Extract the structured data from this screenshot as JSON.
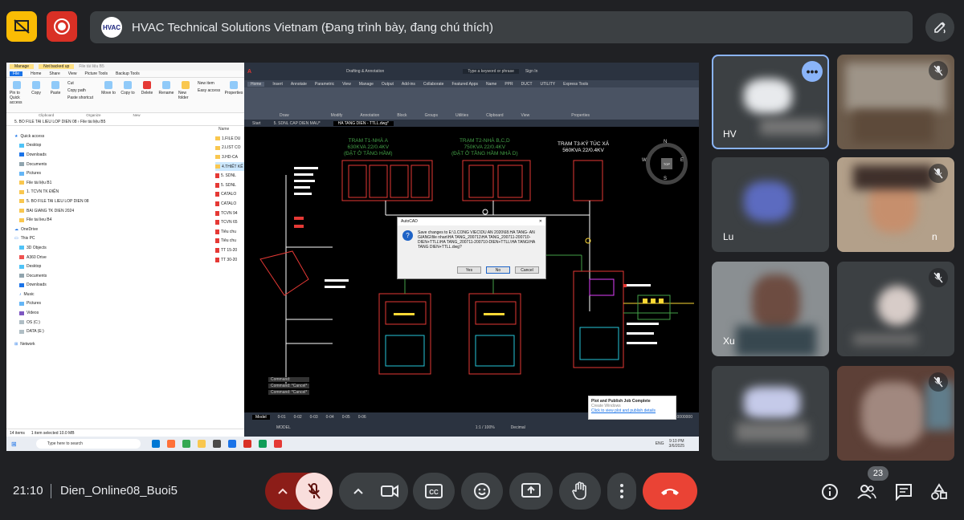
{
  "meet": {
    "presentation_title": "HVAC Technical Solutions Vietnam (Đang trình bày, đang chú thích)",
    "presenter_logo_text": "HVAC",
    "time": "21:10",
    "meeting_name": "Dien_Online08_Buoi5",
    "participant_count": "23",
    "colors": {
      "background": "#202124",
      "control": "#3c4043",
      "mic_muted": "#f9dedc",
      "end_call": "#ea4335",
      "highlight": "#8ab4f8"
    }
  },
  "participants": [
    {
      "name": "HV",
      "muted": false,
      "active_speaker": true
    },
    {
      "name": "",
      "muted": true
    },
    {
      "name": "Lu",
      "muted": false,
      "name_suffix": "n"
    },
    {
      "name": "",
      "muted": true
    },
    {
      "name": "Xu",
      "muted": false
    },
    {
      "name": "",
      "muted": true
    },
    {
      "name": "",
      "muted": false
    },
    {
      "name": "",
      "muted": true
    }
  ],
  "explorer": {
    "title_tabs": [
      "Manage",
      "Not backed up",
      "File tài liệu B5"
    ],
    "ribbon_tabs": [
      "File",
      "Home",
      "Share",
      "View",
      "Picture Tools",
      "Backup Tools"
    ],
    "ribbon_items": [
      "Pin to Quick access",
      "Copy",
      "Paste",
      "Cut",
      "Copy path",
      "Paste shortcut",
      "Move to",
      "Copy to",
      "Delete",
      "Rename",
      "New folder",
      "New item",
      "Easy access",
      "Properties"
    ],
    "ribbon_groups": [
      "Clipboard",
      "Organize",
      "New"
    ],
    "address": "5. BO FILE TAI LIEU LOP DIEN 08 › File tài liệu B5",
    "nav": [
      "Quick access",
      "Desktop",
      "Downloads",
      "Documents",
      "Pictures",
      "File tài liệu B1",
      "1. TCVN TK ĐIỆN",
      "5. BO FILE TAI LIEU LOP DIEN 08",
      "BAI GIANG TK DIEN 2024",
      "File tai lieu B4",
      "OneDrive",
      "This PC",
      "3D Objects",
      "A360 Drive",
      "Desktop",
      "Documents",
      "Downloads",
      "Music",
      "Pictures",
      "Videos",
      "OS (C:)",
      "DATA (E:)",
      "Network"
    ],
    "list_header": "Name",
    "list": [
      "1.FILE DU",
      "2.LIST CO",
      "3.HD-CA",
      "4.THIẾT KẾ",
      "5. SDNL",
      "5. SDNL",
      "CATALO",
      "CATALO",
      "TCVN 94",
      "TCVN 65",
      "Tiêu chu",
      "Tiêu chu",
      "TT 15-20",
      "TT 30-20"
    ],
    "status_count": "14 items",
    "status_selected": "1 item selected 10.0 MB"
  },
  "autocad": {
    "workspace": "Drafting & Annotation",
    "search_placeholder": "Type a keyword or phrase",
    "signin": "Sign In",
    "ribbon_tabs": [
      "Home",
      "Insert",
      "Annotate",
      "Parametric",
      "View",
      "Manage",
      "Output",
      "Add-ins",
      "Collaborate",
      "Featured Apps",
      "Name",
      "PPR",
      "DUCT",
      "UTILITY",
      "Express Tools"
    ],
    "panels": [
      "Draw",
      "Modify",
      "Annotation",
      "Block",
      "Groups",
      "Utilities",
      "Clipboard",
      "View",
      "Properties"
    ],
    "doc_tabs": [
      "Start",
      "5. SDNL CAP DIEN MAU*",
      "HA TANG DIEN - TTLL.dwg*"
    ],
    "stations": [
      {
        "name": "TRAM T1-NHÀ A",
        "rating": "630KVA 22/0.4KV",
        "note": "(ĐẶT Ở TẦNG HẦM)"
      },
      {
        "name": "TRẠM T2-NHÀ B,C,D",
        "rating": "750KVA 22/0.4KV",
        "note": "(ĐẶT Ở TẦNG HẦM NHÀ D)"
      },
      {
        "name": "TRẠM T3-KÝ TÚC XÁ",
        "rating": "560KVA 22/0.4KV",
        "note": ""
      }
    ],
    "viewcube": {
      "top": "TOP",
      "n": "N",
      "s": "S",
      "e": "E",
      "w": "W"
    },
    "dialog": {
      "title": "AutoCAD",
      "message": "Save changes to E:\\1.CONG VIEC\\DU AN 2020\\68.HA TANG- AN GIANG\\file nhan\\HA TANG_200711\\HA TANG_200711-200710-DIEN+TTLL\\HA TANG_200711-200710-DIEN+TTLL\\HA TANG\\HA TANG DIEN+TTLL.dwg?",
      "yes": "Yes",
      "no": "No",
      "cancel": "Cancel"
    },
    "commands": [
      "Command:",
      "Command: *Cancel*",
      "Command: *Cancel*"
    ],
    "layouts": [
      "Model",
      "0-01",
      "0-02",
      "0-03",
      "0-04",
      "0-05",
      "0-06"
    ],
    "coords": "0.0000000",
    "status_model": "MODEL",
    "scale": "1:1 / 100%",
    "units": "Decimal",
    "notification_title": "Plot and Publish Job Complete",
    "notification_body": "Click to view plot and publish details",
    "activate_windows": "Create Windows"
  },
  "taskbar": {
    "search_placeholder": "Type here to search",
    "time": "9:10 PM",
    "date": "3/6/2025",
    "lang": "ENG"
  }
}
